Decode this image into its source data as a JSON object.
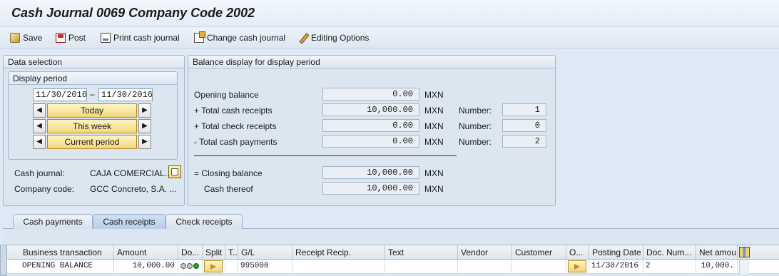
{
  "window": {
    "title": "Cash Journal 0069 Company Code 2002"
  },
  "toolbar": {
    "save": "Save",
    "post": "Post",
    "print": "Print cash journal",
    "change": "Change cash journal",
    "editing": "Editing Options"
  },
  "data_selection": {
    "title": "Data selection",
    "display_period": {
      "title": "Display period",
      "date_from": "11/30/2016",
      "dash": "–",
      "date_to": "11/30/2016",
      "today": "Today",
      "this_week": "This week",
      "current_period": "Current period"
    },
    "cash_journal_label": "Cash journal:",
    "cash_journal_value": "CAJA COMERCIAL...",
    "company_code_label": "Company code:",
    "company_code_value": "GCC Concreto, S.A. ..."
  },
  "balance": {
    "title": "Balance display for display period",
    "currency": "MXN",
    "number_label": "Number:",
    "rows": [
      {
        "label": "Opening balance",
        "amount": "0.00"
      },
      {
        "label": "+ Total cash receipts",
        "amount": "10,000.00",
        "number": "1"
      },
      {
        "label": "+ Total check receipts",
        "amount": "0.00",
        "number": "0"
      },
      {
        "label": "- Total cash payments",
        "amount": "0.00",
        "number": "2"
      },
      {
        "label": "= Closing balance",
        "amount": "10,000.00"
      },
      {
        "label": "Cash thereof",
        "amount": "10,000.00"
      }
    ]
  },
  "tabs": [
    "Cash payments",
    "Cash receipts",
    "Check receipts"
  ],
  "active_tab": "Cash receipts",
  "grid": {
    "headers": [
      "Business transaction",
      "Amount",
      "Do...",
      "Split",
      "T..",
      "G/L",
      "Receipt Recip.",
      "Text",
      "Vendor",
      "Customer",
      "O...",
      "Posting Date",
      "Doc. Num...",
      "Net amou"
    ],
    "row": {
      "transaction": "OPENING BALANCE",
      "amount": "10,000.00",
      "gl": "995000",
      "posting_date": "11/30/2016",
      "doc_num": "2",
      "net_amount": "10,000."
    }
  },
  "colors": {
    "accent_button": "#f1d77d",
    "panel_bg": "#dce6f1",
    "status_grey": "#c8c8c8",
    "status_green": "#22aa22"
  }
}
